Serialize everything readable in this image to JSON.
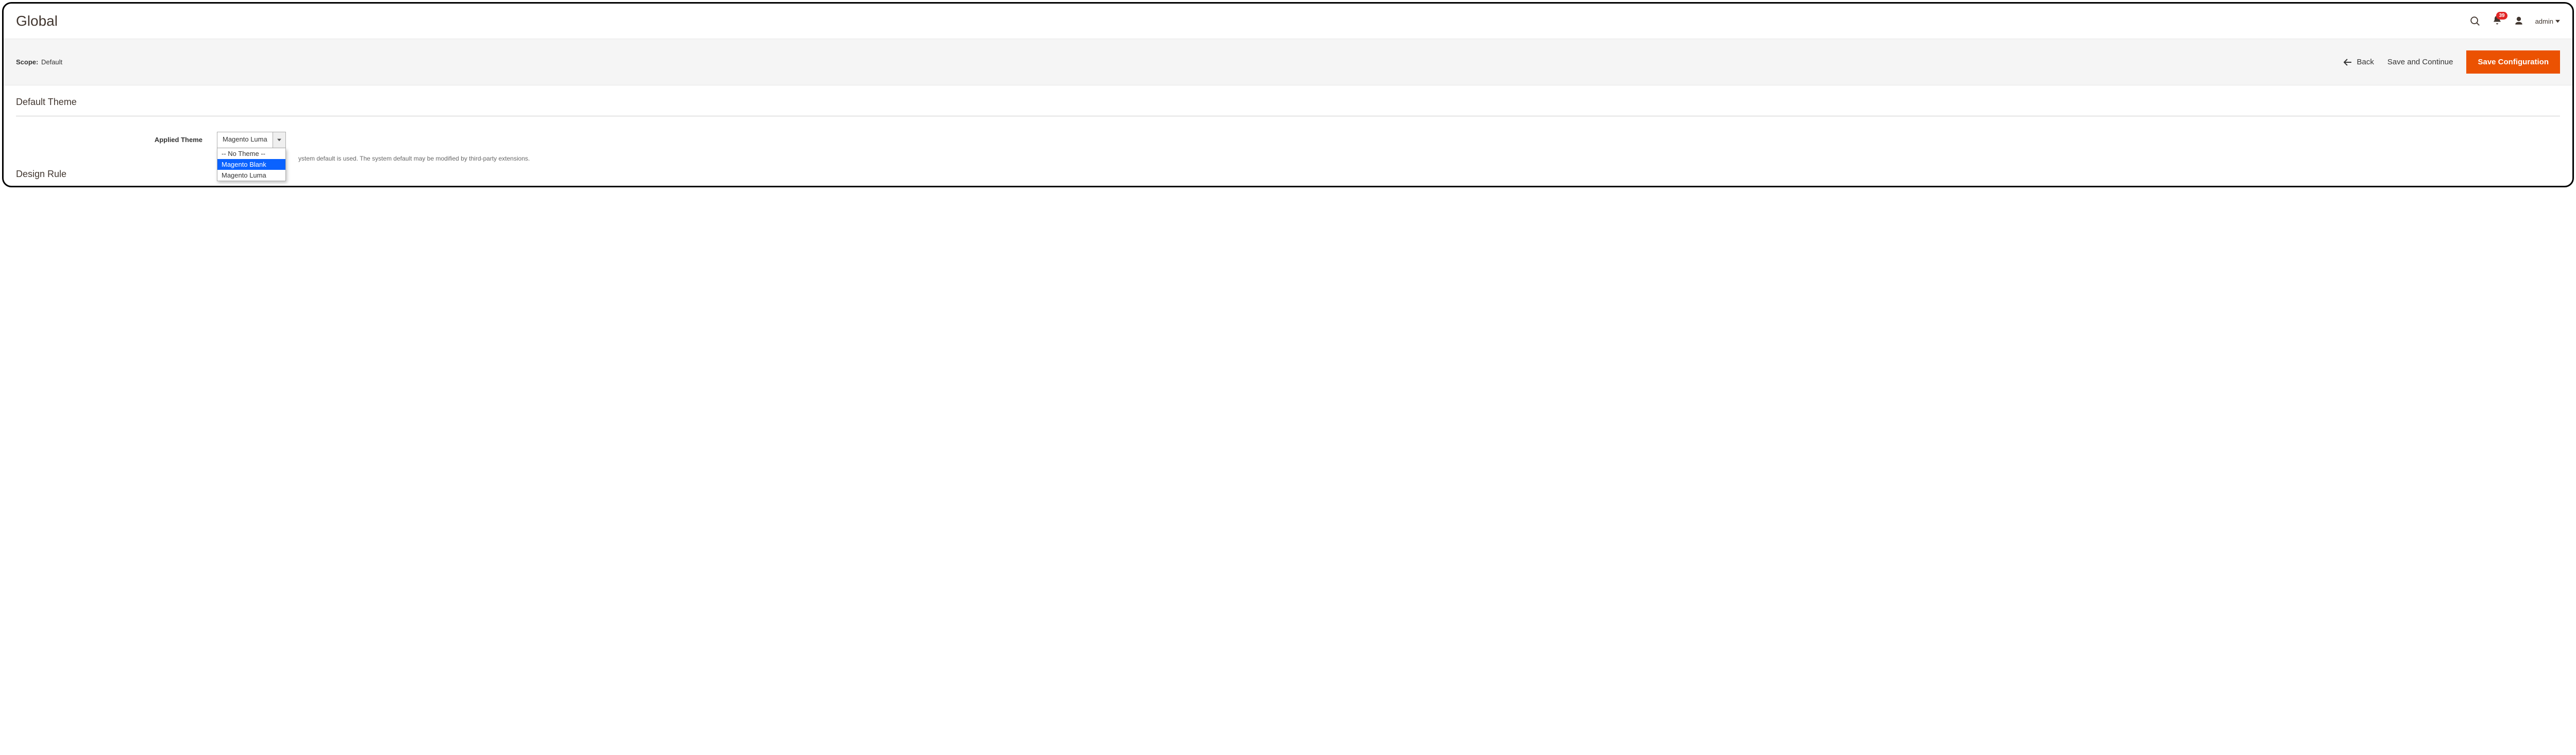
{
  "header": {
    "title": "Global",
    "notification_count": "39",
    "user_label": "admin"
  },
  "toolbar": {
    "scope_label": "Scope:",
    "scope_value": "Default",
    "back_label": "Back",
    "save_continue_label": "Save and Continue",
    "save_config_label": "Save Configuration"
  },
  "sections": {
    "default_theme": {
      "title": "Default Theme",
      "applied_theme_label": "Applied Theme",
      "selected_value": "Magento Luma",
      "hint_tail": "ystem default is used. The system default may be modified by third-party extensions.",
      "options": [
        "-- No Theme --",
        "Magento Blank",
        "Magento Luma"
      ],
      "highlighted_index": 1
    },
    "design_rule": {
      "title": "Design Rule"
    }
  }
}
